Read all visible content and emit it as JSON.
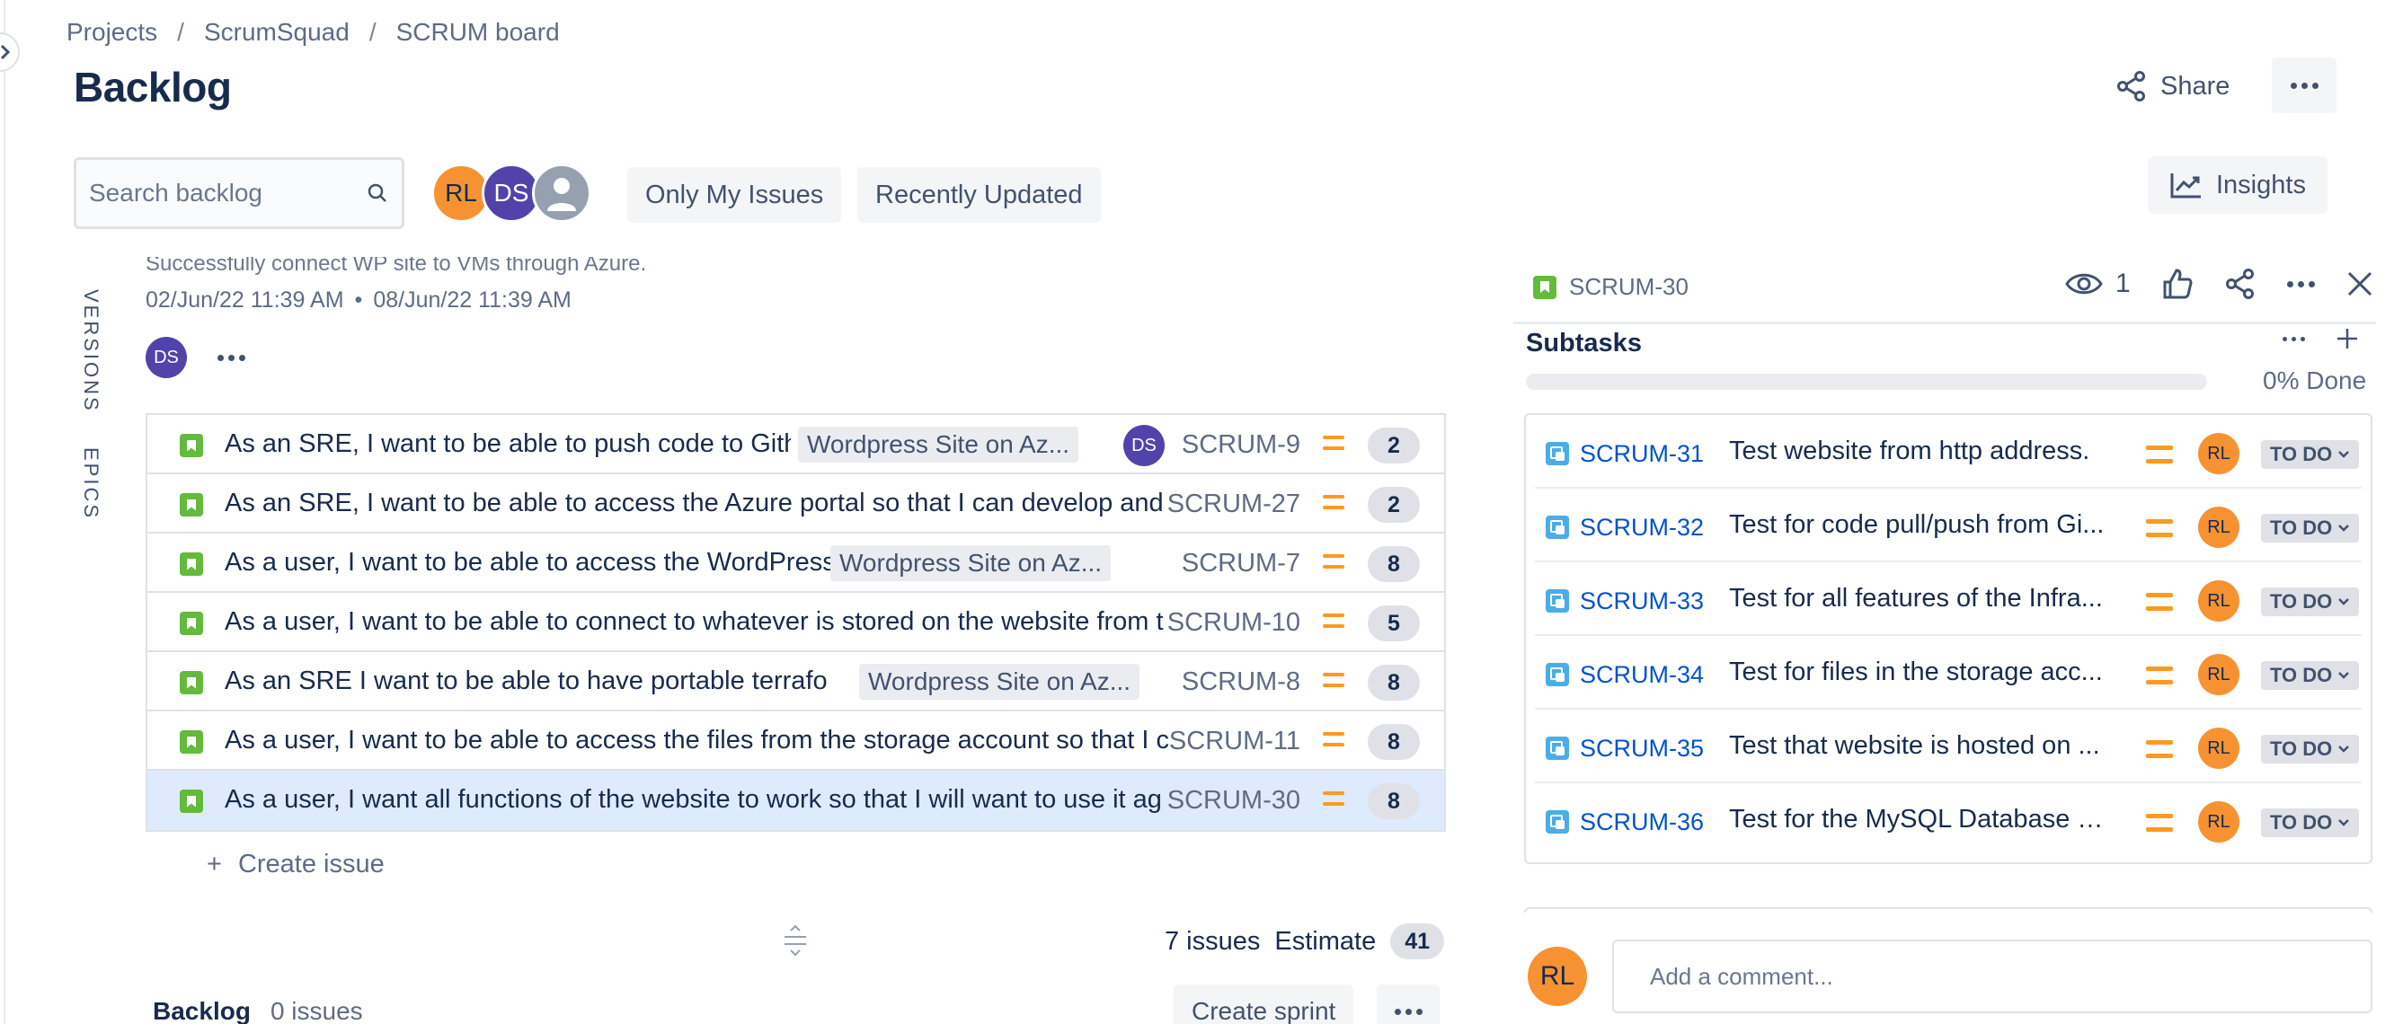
{
  "breadcrumb": [
    "Projects",
    "ScrumSquad",
    "SCRUM board"
  ],
  "page_title": "Backlog",
  "header": {
    "share_label": "Share"
  },
  "toolbar": {
    "search_placeholder": "Search backlog",
    "avatars": [
      {
        "initials": "RL",
        "color": "#f79232"
      },
      {
        "initials": "DS",
        "color": "#5243aa"
      },
      {
        "initials": "",
        "color": "#97a0af"
      }
    ],
    "only_my_issues": "Only My Issues",
    "recently_updated": "Recently Updated",
    "insights": "Insights"
  },
  "side_tabs": {
    "versions": "VERSIONS",
    "epics": "EPICS"
  },
  "sprint": {
    "goal": "Successfully connect WP site to VMs through Azure.",
    "start": "02/Jun/22 11:39 AM",
    "bullet": "•",
    "end": "08/Jun/22 11:39 AM",
    "assignee": "DS",
    "issues": [
      {
        "summary": "As an SRE, I want to be able to push code to Gith",
        "epic": "Wordpress Site on Az...",
        "assignee": "DS",
        "key": "SCRUM-9",
        "points": "2",
        "selected": false
      },
      {
        "summary": "As an SRE, I want to be able to access the Azure portal so that I can develop and",
        "epic": "",
        "assignee": "",
        "key": "SCRUM-27",
        "points": "2",
        "selected": false
      },
      {
        "summary": "As a user, I want to be able to access the WordPress W",
        "epic": "Wordpress Site on Az...",
        "assignee": "",
        "key": "SCRUM-7",
        "points": "8",
        "selected": false
      },
      {
        "summary": "As a user, I want to be able to connect to whatever is stored on the website from t",
        "epic": "",
        "assignee": "",
        "key": "SCRUM-10",
        "points": "5",
        "selected": false
      },
      {
        "summary": "As an SRE I want to be able to have portable terraform",
        "epic": "Wordpress Site on Az...",
        "assignee": "",
        "key": "SCRUM-8",
        "points": "8",
        "selected": false
      },
      {
        "summary": "As a user, I want to be able to access the files from the storage account so that I c",
        "epic": "",
        "assignee": "",
        "key": "SCRUM-11",
        "points": "8",
        "selected": false
      },
      {
        "summary": "As a user, I want all functions of the website to work so that I will want to use it ag",
        "epic": "",
        "assignee": "",
        "key": "SCRUM-30",
        "points": "8",
        "selected": true
      }
    ],
    "create_issue": "Create issue",
    "issue_count": "7 issues",
    "estimate_label": "Estimate",
    "estimate_total": "41"
  },
  "backlog": {
    "title": "Backlog",
    "count": "0 issues",
    "create_sprint": "Create sprint"
  },
  "detail": {
    "key": "SCRUM-30",
    "watchers": "1",
    "subtasks_title": "Subtasks",
    "progress_label": "0% Done",
    "progress": 0,
    "subtasks": [
      {
        "key": "SCRUM-31",
        "summary": "Test website from http address.",
        "assignee": "RL",
        "status": "TO DO"
      },
      {
        "key": "SCRUM-32",
        "summary": "Test for code pull/push from Gi...",
        "assignee": "RL",
        "status": "TO DO"
      },
      {
        "key": "SCRUM-33",
        "summary": "Test for all features of the Infra...",
        "assignee": "RL",
        "status": "TO DO"
      },
      {
        "key": "SCRUM-34",
        "summary": "Test for files in the storage acc...",
        "assignee": "RL",
        "status": "TO DO"
      },
      {
        "key": "SCRUM-35",
        "summary": "Test that website is hosted on ...",
        "assignee": "RL",
        "status": "TO DO"
      },
      {
        "key": "SCRUM-36",
        "summary": "Test for the MySQL Database h...",
        "assignee": "RL",
        "status": "TO DO"
      }
    ],
    "comment_avatar": "RL",
    "comment_placeholder": "Add a comment..."
  },
  "colors": {
    "story": "#63ba3c",
    "subtask": "#4bade8",
    "priority_medium": "#ff991f",
    "selected_row": "#deebff",
    "link": "#0052cc"
  }
}
